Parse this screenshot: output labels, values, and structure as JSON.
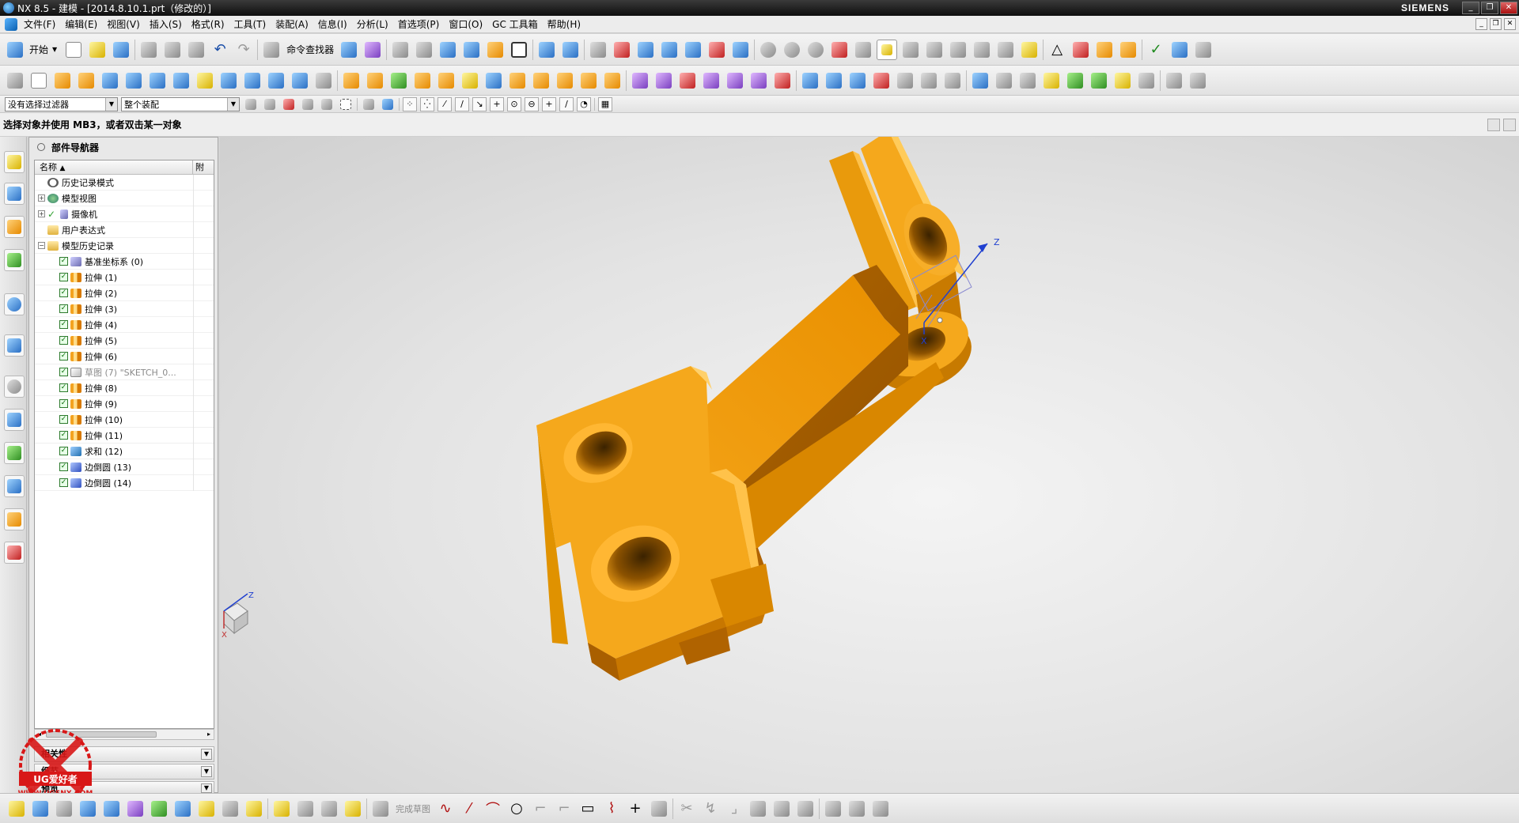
{
  "window": {
    "title": "NX 8.5 - 建模 - [2014.8.10.1.prt（修改的）]",
    "brand": "SIEMENS"
  },
  "menu": {
    "items": [
      "文件(F)",
      "编辑(E)",
      "视图(V)",
      "插入(S)",
      "格式(R)",
      "工具(T)",
      "装配(A)",
      "信息(I)",
      "分析(L)",
      "首选项(P)",
      "窗口(O)",
      "GC 工具箱",
      "帮助(H)"
    ]
  },
  "toolbar": {
    "start_label": "开始",
    "command_finder_label": "命令查找器"
  },
  "selection": {
    "filter_value": "没有选择过滤器",
    "scope_value": "整个装配"
  },
  "cue": {
    "text": "选择对象并使用 MB3，或者双击某一对象"
  },
  "navigator": {
    "title": "部件导航器",
    "col_name": "名称",
    "col_extra": "附",
    "nodes": [
      {
        "label": "历史记录模式"
      },
      {
        "label": "模型视图"
      },
      {
        "label": "摄像机"
      },
      {
        "label": "用户表达式"
      },
      {
        "label": "模型历史记录"
      },
      {
        "label": "基准坐标系 (0)"
      },
      {
        "label": "拉伸 (1)"
      },
      {
        "label": "拉伸 (2)"
      },
      {
        "label": "拉伸 (3)"
      },
      {
        "label": "拉伸 (4)"
      },
      {
        "label": "拉伸 (5)"
      },
      {
        "label": "拉伸 (6)"
      },
      {
        "label": "草图 (7) \"SKETCH_0..."
      },
      {
        "label": "拉伸 (8)"
      },
      {
        "label": "拉伸 (9)"
      },
      {
        "label": "拉伸 (10)"
      },
      {
        "label": "拉伸 (11)"
      },
      {
        "label": "求和 (12)"
      },
      {
        "label": "边倒圆 (13)"
      },
      {
        "label": "边倒圆 (14)"
      }
    ],
    "panel_details": "细节",
    "panel_related": "相关性",
    "panel_preview": "预览"
  },
  "bottom": {
    "finish_sketch_label": "完成草图"
  },
  "graphics": {
    "axis_z": "Z",
    "axis_x": "X",
    "triad_z": "Z",
    "triad_x": "X"
  },
  "watermark": {
    "line1": "UG爱好者",
    "line2": "WWW.UGSNX.COM"
  },
  "colors": {
    "part_main": "#F5A81C",
    "part_shadow": "#B86A00",
    "part_light": "#FFC54A",
    "axis_blue": "#2040d0",
    "watermark_red": "#d81818"
  }
}
